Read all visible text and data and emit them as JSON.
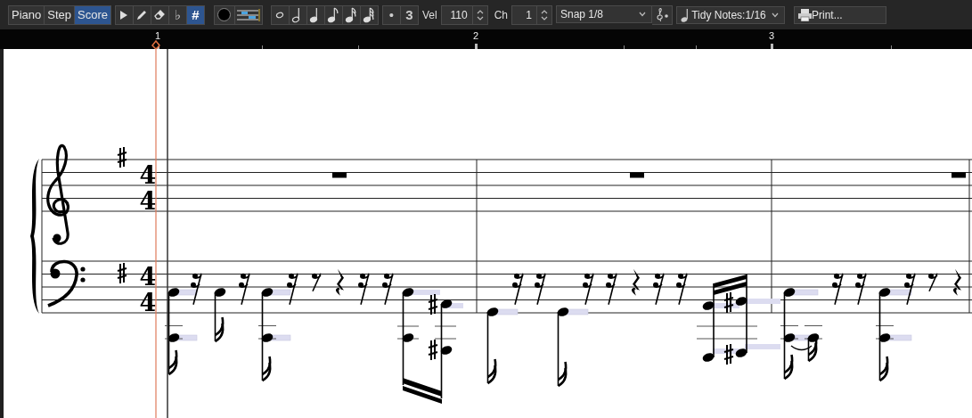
{
  "modes": [
    {
      "label": "Piano",
      "selected": false
    },
    {
      "label": "Step",
      "selected": false
    },
    {
      "label": "Score",
      "selected": true
    }
  ],
  "tools": [
    {
      "kind": "pointer",
      "selected": false
    },
    {
      "kind": "pencil",
      "selected": false
    },
    {
      "kind": "eraser",
      "selected": false
    },
    {
      "kind": "flat",
      "label": "♭",
      "selected": false
    },
    {
      "kind": "sharp",
      "label": "#",
      "selected": true
    }
  ],
  "durations": [
    {
      "kind": "whole"
    },
    {
      "kind": "half"
    },
    {
      "kind": "quarter"
    },
    {
      "kind": "eighth"
    },
    {
      "kind": "sixteenth"
    },
    {
      "kind": "thirty-second"
    }
  ],
  "dot_button": {
    "label": "•"
  },
  "triplet_button": {
    "label": "3"
  },
  "velocity": {
    "label": "Vel",
    "value": "110"
  },
  "channel": {
    "label": "Ch",
    "value": "1"
  },
  "snap": {
    "value": "Snap 1/8"
  },
  "tidy": {
    "value": "Tidy Notes:1/16"
  },
  "print": {
    "label": "Print..."
  },
  "ruler": {
    "bars": [
      {
        "label": "1"
      },
      {
        "label": "2"
      },
      {
        "label": "3"
      }
    ]
  },
  "score": {
    "staves": [
      {
        "kind": "treble",
        "time_signature": [
          "4",
          "4"
        ]
      },
      {
        "kind": "bass",
        "time_signature": [
          "4",
          "4"
        ]
      }
    ]
  }
}
